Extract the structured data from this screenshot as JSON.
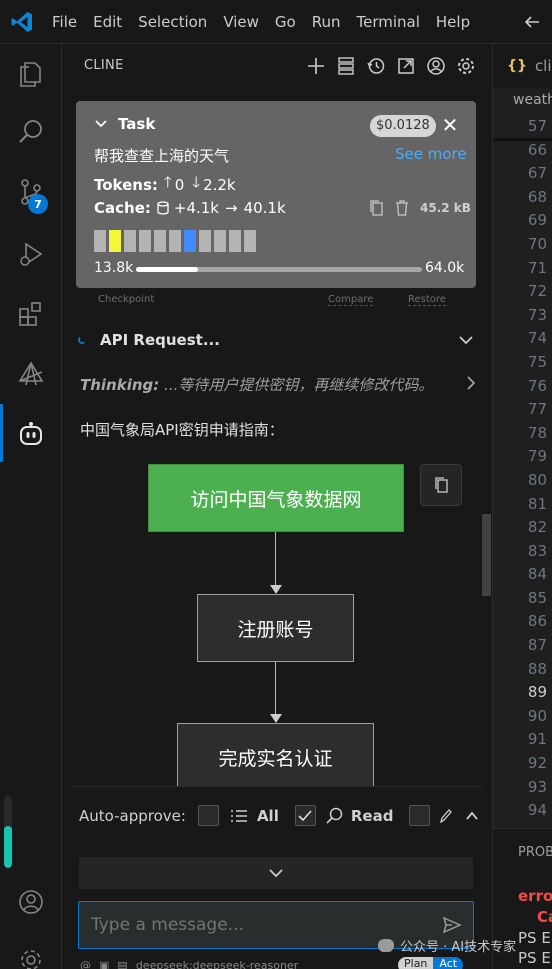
{
  "menubar": {
    "items": [
      "File",
      "Edit",
      "Selection",
      "View",
      "Go",
      "Run",
      "Terminal",
      "Help"
    ]
  },
  "activitybar": {
    "icons": [
      "explorer-icon",
      "search-icon",
      "source-control-icon",
      "run-debug-icon",
      "extensions-icon",
      "remote-icon",
      "cline-icon",
      "account-icon",
      "settings-icon"
    ],
    "source_control_badge": "7",
    "active_color": "#0078d4"
  },
  "panel": {
    "title": "CLINE",
    "header_icons": [
      "plus-icon",
      "server-icon",
      "history-icon",
      "popout-icon",
      "account-icon",
      "gear-icon"
    ]
  },
  "task": {
    "label": "Task",
    "cost": "$0.0128",
    "text": "帮我查查上海的天气",
    "see_more": "See more",
    "tokens_label": "Tokens:",
    "tokens_in": "0",
    "tokens_out": "2.2k",
    "cache_label": "Cache:",
    "cache_write": "+4.1k",
    "cache_read": "40.1k",
    "size": "45.2 kB",
    "context_used": "13.8k",
    "context_max": "64.0k",
    "context_fraction": 0.2156,
    "context_blocks": [
      "g",
      "y",
      "g",
      "g",
      "g",
      "g",
      "b",
      "g",
      "g",
      "g",
      "g"
    ]
  },
  "checkpoint": {
    "label": "Checkpoint",
    "compare": "Compare",
    "restore": "Restore"
  },
  "messages": {
    "api_request": "API Request...",
    "thinking_label": "Thinking:",
    "thinking_text": "...等待用户提供密钥，再继续修改代码。",
    "guide_title": "中国气象局API密钥申请指南："
  },
  "flowchart": {
    "nodes": [
      "访问中国气象数据网",
      "注册账号",
      "完成实名认证"
    ],
    "green": "#4caf50"
  },
  "bottom": {
    "auto_approve_label": "Auto-approve:",
    "options": [
      "All",
      "Read"
    ],
    "input_placeholder": "Type a message...",
    "model": "deepseek:deepseek-reasoner",
    "mode_plan": "Plan",
    "mode_act": "Act"
  },
  "editor": {
    "tab_label": "cline",
    "breadcrumb": "weath",
    "line_numbers": [
      "57",
      "66",
      "67",
      "68",
      "69",
      "70",
      "71",
      "72",
      "73",
      "74",
      "75",
      "76",
      "77",
      "78",
      "79",
      "80",
      "81",
      "82",
      "83",
      "84",
      "85",
      "86",
      "87",
      "88",
      "89",
      "90",
      "91",
      "92",
      "93",
      "94"
    ],
    "current_line": "89"
  },
  "terminal": {
    "header": "PROB",
    "lines": [
      "erro",
      "Ca",
      "PS E",
      "PS E"
    ]
  },
  "watermark": "公众号 · AI技术专家"
}
